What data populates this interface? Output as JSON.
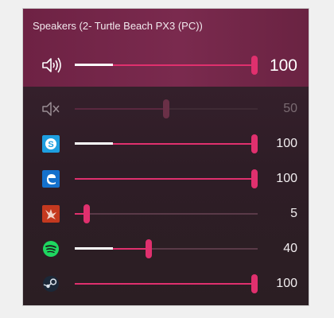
{
  "device": {
    "name": "Speakers (2- Turtle Beach PX3 (PC))"
  },
  "master": {
    "icon": "speaker-volume-icon",
    "volume": 100,
    "value_label": "100"
  },
  "apps": [
    {
      "icon": "system-sounds-muted-icon",
      "volume": 50,
      "value_label": "50",
      "disabled": true
    },
    {
      "icon": "skype-icon",
      "volume": 100,
      "value_label": "100"
    },
    {
      "icon": "edge-icon",
      "volume": 100,
      "value_label": "100"
    },
    {
      "icon": "rust-game-icon",
      "volume": 5,
      "value_label": "5"
    },
    {
      "icon": "spotify-icon",
      "volume": 40,
      "value_label": "40"
    },
    {
      "icon": "steam-icon",
      "volume": 100,
      "value_label": "100"
    }
  ],
  "colors": {
    "accent": "#e0306e",
    "header_bg": "#7a2a4e",
    "panel_bg": "#2e1d26"
  }
}
